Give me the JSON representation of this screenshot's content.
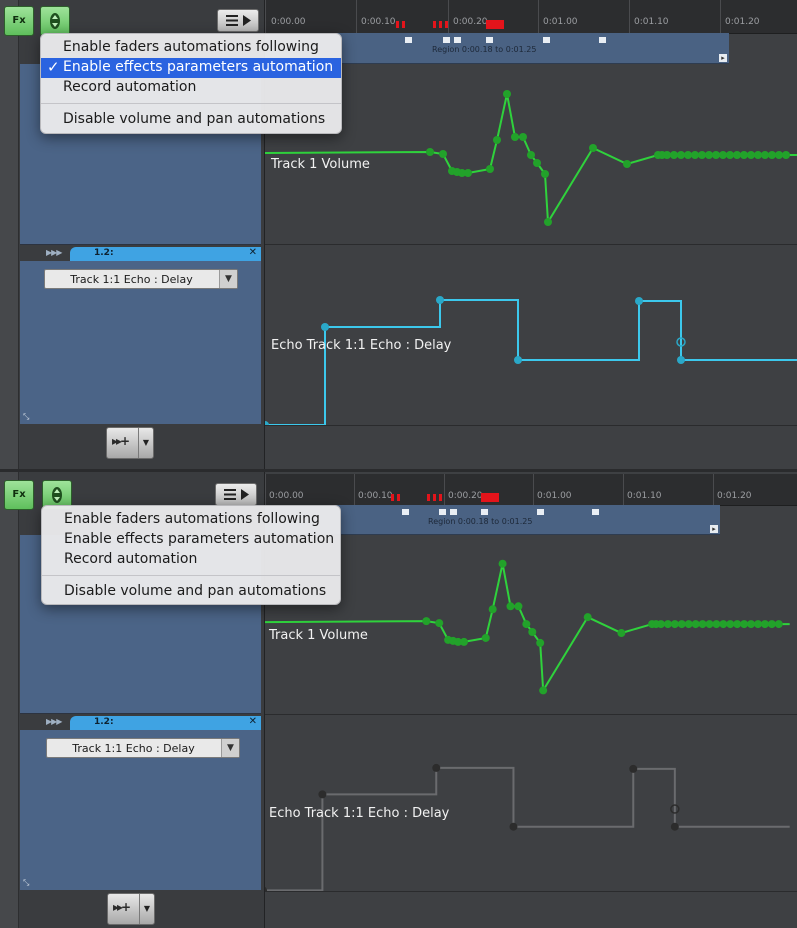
{
  "toolbar": {
    "fx_label": "Fx"
  },
  "ruler": {
    "ticks": [
      "0:00.00",
      "0:00.10",
      "0:00.20",
      "0:01.00",
      "0:01.10",
      "0:01.20"
    ]
  },
  "region": {
    "label": "Region 0:00.18 to 0:01.25"
  },
  "lane": {
    "number": "1.2:"
  },
  "param_select": {
    "value": "Track 1:1 Echo : Delay"
  },
  "tracks": {
    "volume_label": "Track 1 Volume",
    "echo_label": "Echo Track 1:1 Echo : Delay"
  },
  "menu": {
    "items": [
      "Enable faders automations following",
      "Enable effects parameters automation",
      "Record automation",
      "Disable volume and pan automations"
    ],
    "check_glyph": "✓"
  },
  "states": [
    {
      "id": "a",
      "effects_automation_checked": true,
      "echo_color": "#3cc8ec",
      "echo_point_color": "#2aa8c8"
    },
    {
      "id": "b",
      "effects_automation_checked": false,
      "echo_color": "#6a6b6e",
      "echo_point_color": "#2c2c2c"
    }
  ],
  "colors": {
    "volume_line": "#2fd23c",
    "volume_point": "#22a22a",
    "lane_tab": "#3fa3e3",
    "track_panel": "#4b6487"
  }
}
